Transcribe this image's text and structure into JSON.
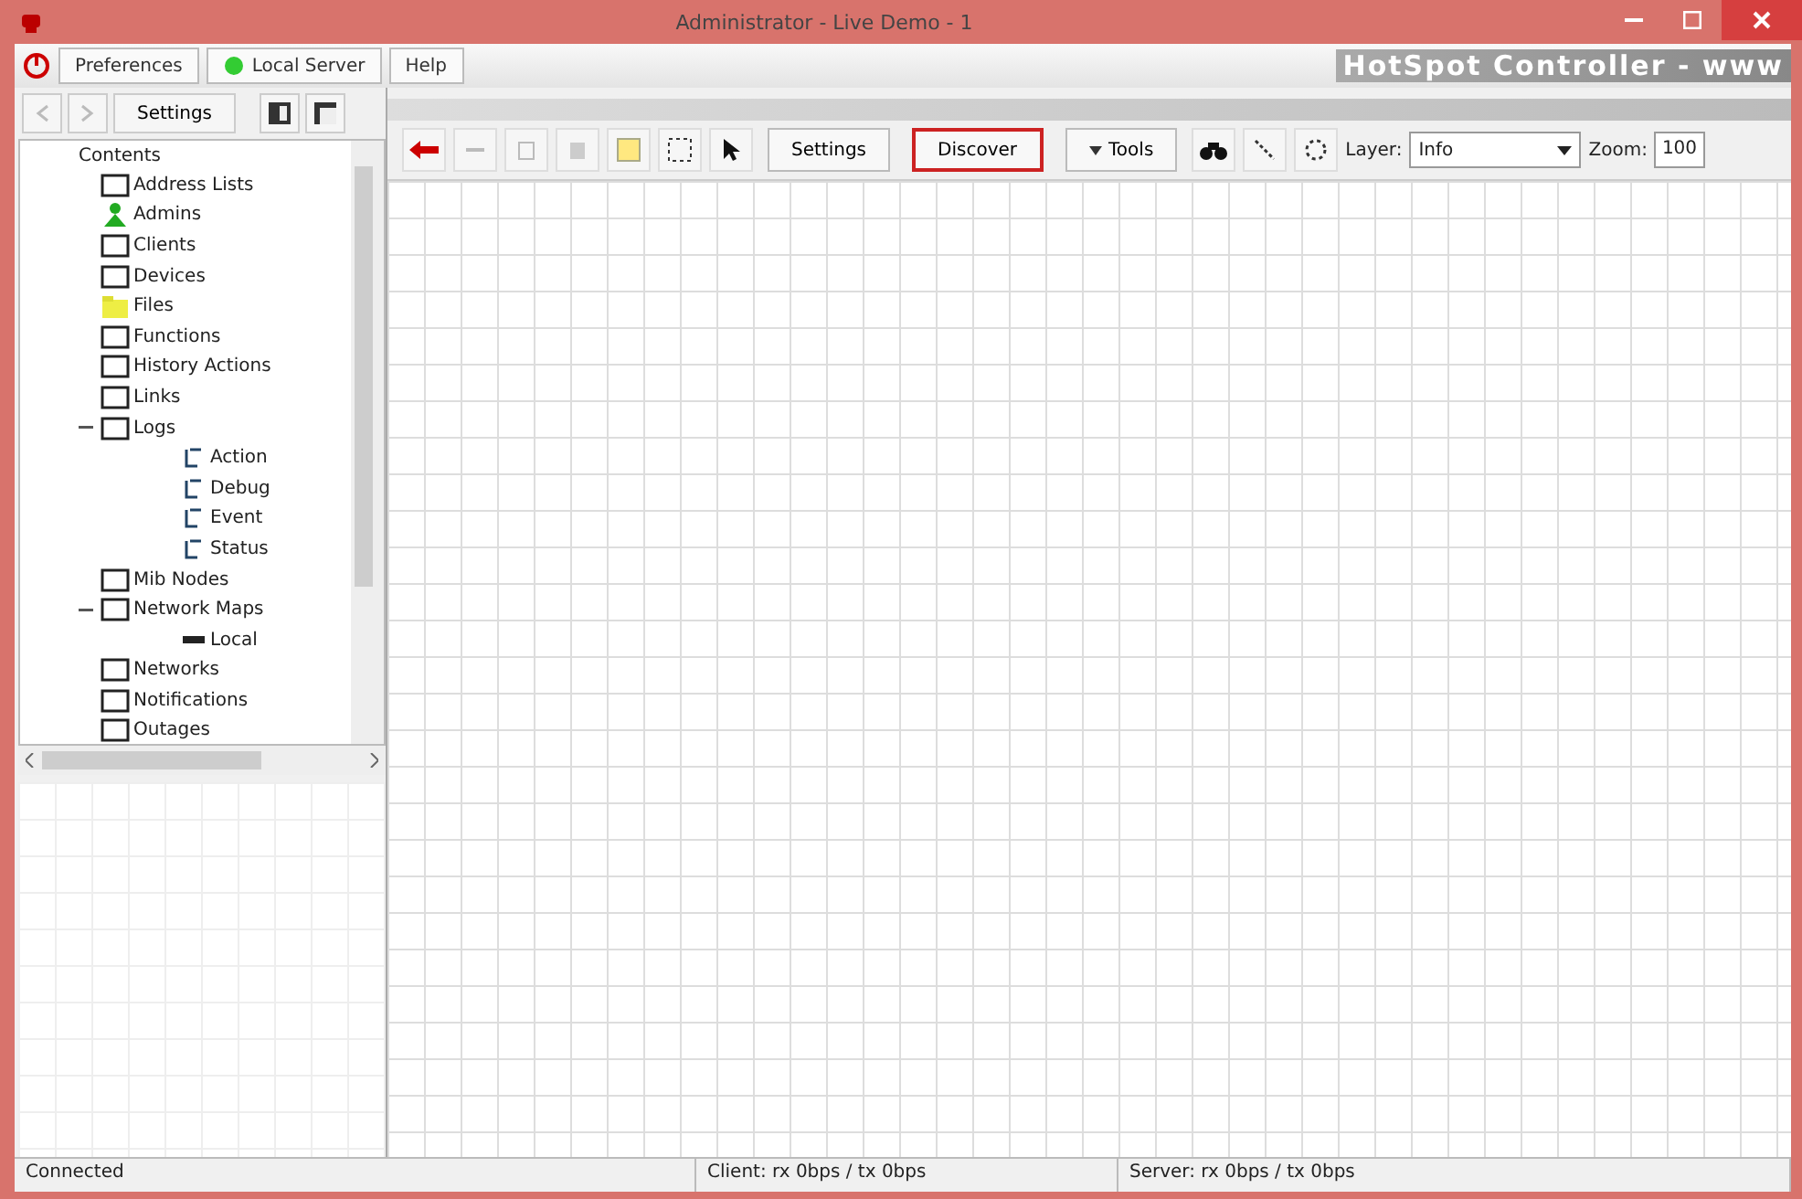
{
  "window": {
    "title": "Administrator - Live Demo - 1"
  },
  "menu": [
    {
      "label": "Preferences",
      "kind": "plain"
    },
    {
      "label": "Local Server",
      "kind": "status"
    },
    {
      "label": "Help",
      "kind": "plain"
    }
  ],
  "brand": "HotSpot Controller - www",
  "sidebar": {
    "settings_button": "Settings",
    "tree": {
      "label": "Contents",
      "children": [
        {
          "label": "Address Lists",
          "kind": "box"
        },
        {
          "label": "Admins",
          "kind": "person"
        },
        {
          "label": "Clients",
          "kind": "box"
        },
        {
          "label": "Devices",
          "kind": "box"
        },
        {
          "label": "Files",
          "kind": "folder"
        },
        {
          "label": "Functions",
          "kind": "box"
        },
        {
          "label": "History Actions",
          "kind": "box"
        },
        {
          "label": "Links",
          "kind": "box"
        },
        {
          "label": "Logs",
          "kind": "box",
          "expanded": true,
          "children": [
            {
              "label": "Action",
              "kind": "log"
            },
            {
              "label": "Debug",
              "kind": "log"
            },
            {
              "label": "Event",
              "kind": "log"
            },
            {
              "label": "Status",
              "kind": "log"
            }
          ]
        },
        {
          "label": "Mib Nodes",
          "kind": "box"
        },
        {
          "label": "Network Maps",
          "kind": "box",
          "expanded": true,
          "children": [
            {
              "label": "Local",
              "kind": "map"
            }
          ]
        },
        {
          "label": "Networks",
          "kind": "box"
        },
        {
          "label": "Notifications",
          "kind": "box"
        },
        {
          "label": "Outages",
          "kind": "box"
        }
      ]
    }
  },
  "toolbar": {
    "settings": "Settings",
    "discover": {
      "label": "Discover",
      "selected": true
    },
    "tools": "Tools",
    "layer_label": "Layer:",
    "layer_value": "Info",
    "zoom_label": "Zoom:",
    "zoom_value": "100"
  },
  "status_bar": [
    "Connected",
    "Client: rx 0bps / tx 0bps",
    "Server: rx 0bps / tx 0bps"
  ]
}
